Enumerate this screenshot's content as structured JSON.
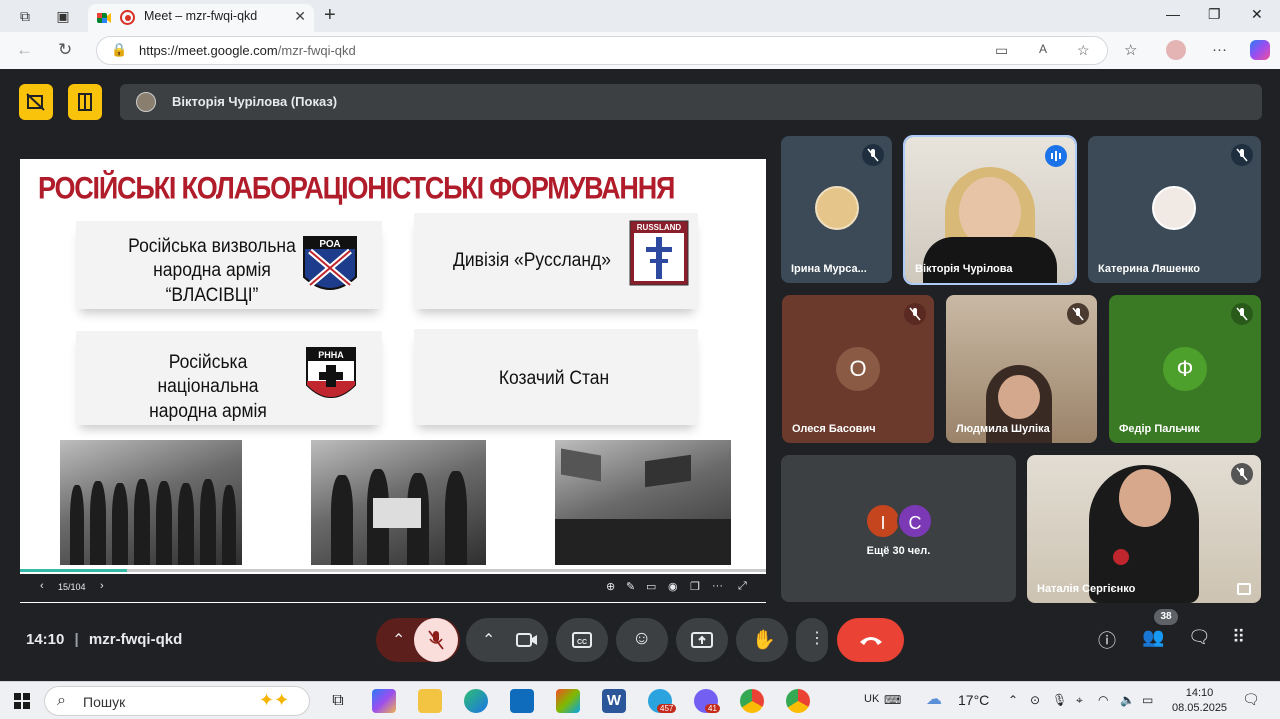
{
  "browser": {
    "tab_title": "Meet – mzr-fwqi-qkd",
    "url_host": "https://meet.google.com",
    "url_path": "/mzr-fwqi-qkd"
  },
  "meet": {
    "presenter_label": "Вікторія Чурілова (Показ)",
    "slide": {
      "title": "РОСІЙСЬКІ КОЛАБОРАЦІОНІСТСЬКІ ФОРМУВАННЯ",
      "cards": [
        {
          "text_lines": [
            "Російська визвольна",
            "народна армія",
            "“ВЛАСІВЦІ”"
          ],
          "badge": "РОА"
        },
        {
          "text_lines": [
            "Дивізія «Руссланд»"
          ],
          "badge": "RUSSLAND"
        },
        {
          "text_lines": [
            "Російська національна",
            "народна армія"
          ],
          "badge": "РННА"
        },
        {
          "text_lines": [
            "Козачий Стан"
          ],
          "badge": ""
        }
      ],
      "page_indicator": "15/104",
      "progress_fraction": 0.144
    },
    "participants": [
      {
        "name": "Ірина Мурса...",
        "muted": true
      },
      {
        "name": "Вікторія Чурілова",
        "muted": false,
        "speaking": true
      },
      {
        "name": "Катерина Ляшенко",
        "muted": true
      },
      {
        "name": "Олеся Басович",
        "initial": "О",
        "muted": true
      },
      {
        "name": "Людмила Шуліка",
        "muted": true
      },
      {
        "name": "Федір Пальчик",
        "initial": "Ф",
        "muted": true
      },
      {
        "name": "Наталія Сергієнко",
        "muted": true
      }
    ],
    "others": {
      "initials": [
        "І",
        "С"
      ],
      "label": "Ещё 30 чел."
    },
    "time": "14:10",
    "meeting_code": "mzr-fwqi-qkd",
    "people_count": "38",
    "colors": {
      "accent_yellow": "#f9c20b",
      "end_call": "#ea4335",
      "avatar_brown": "#8a5a44",
      "avatar_green": "#3a8a22"
    }
  },
  "taskbar": {
    "search_placeholder": "Пошук",
    "telegram_badge": "457",
    "viber_badge": "41",
    "lang": "UK",
    "weather": "17°C",
    "clock_time": "14:10",
    "clock_date": "08.05.2025"
  }
}
